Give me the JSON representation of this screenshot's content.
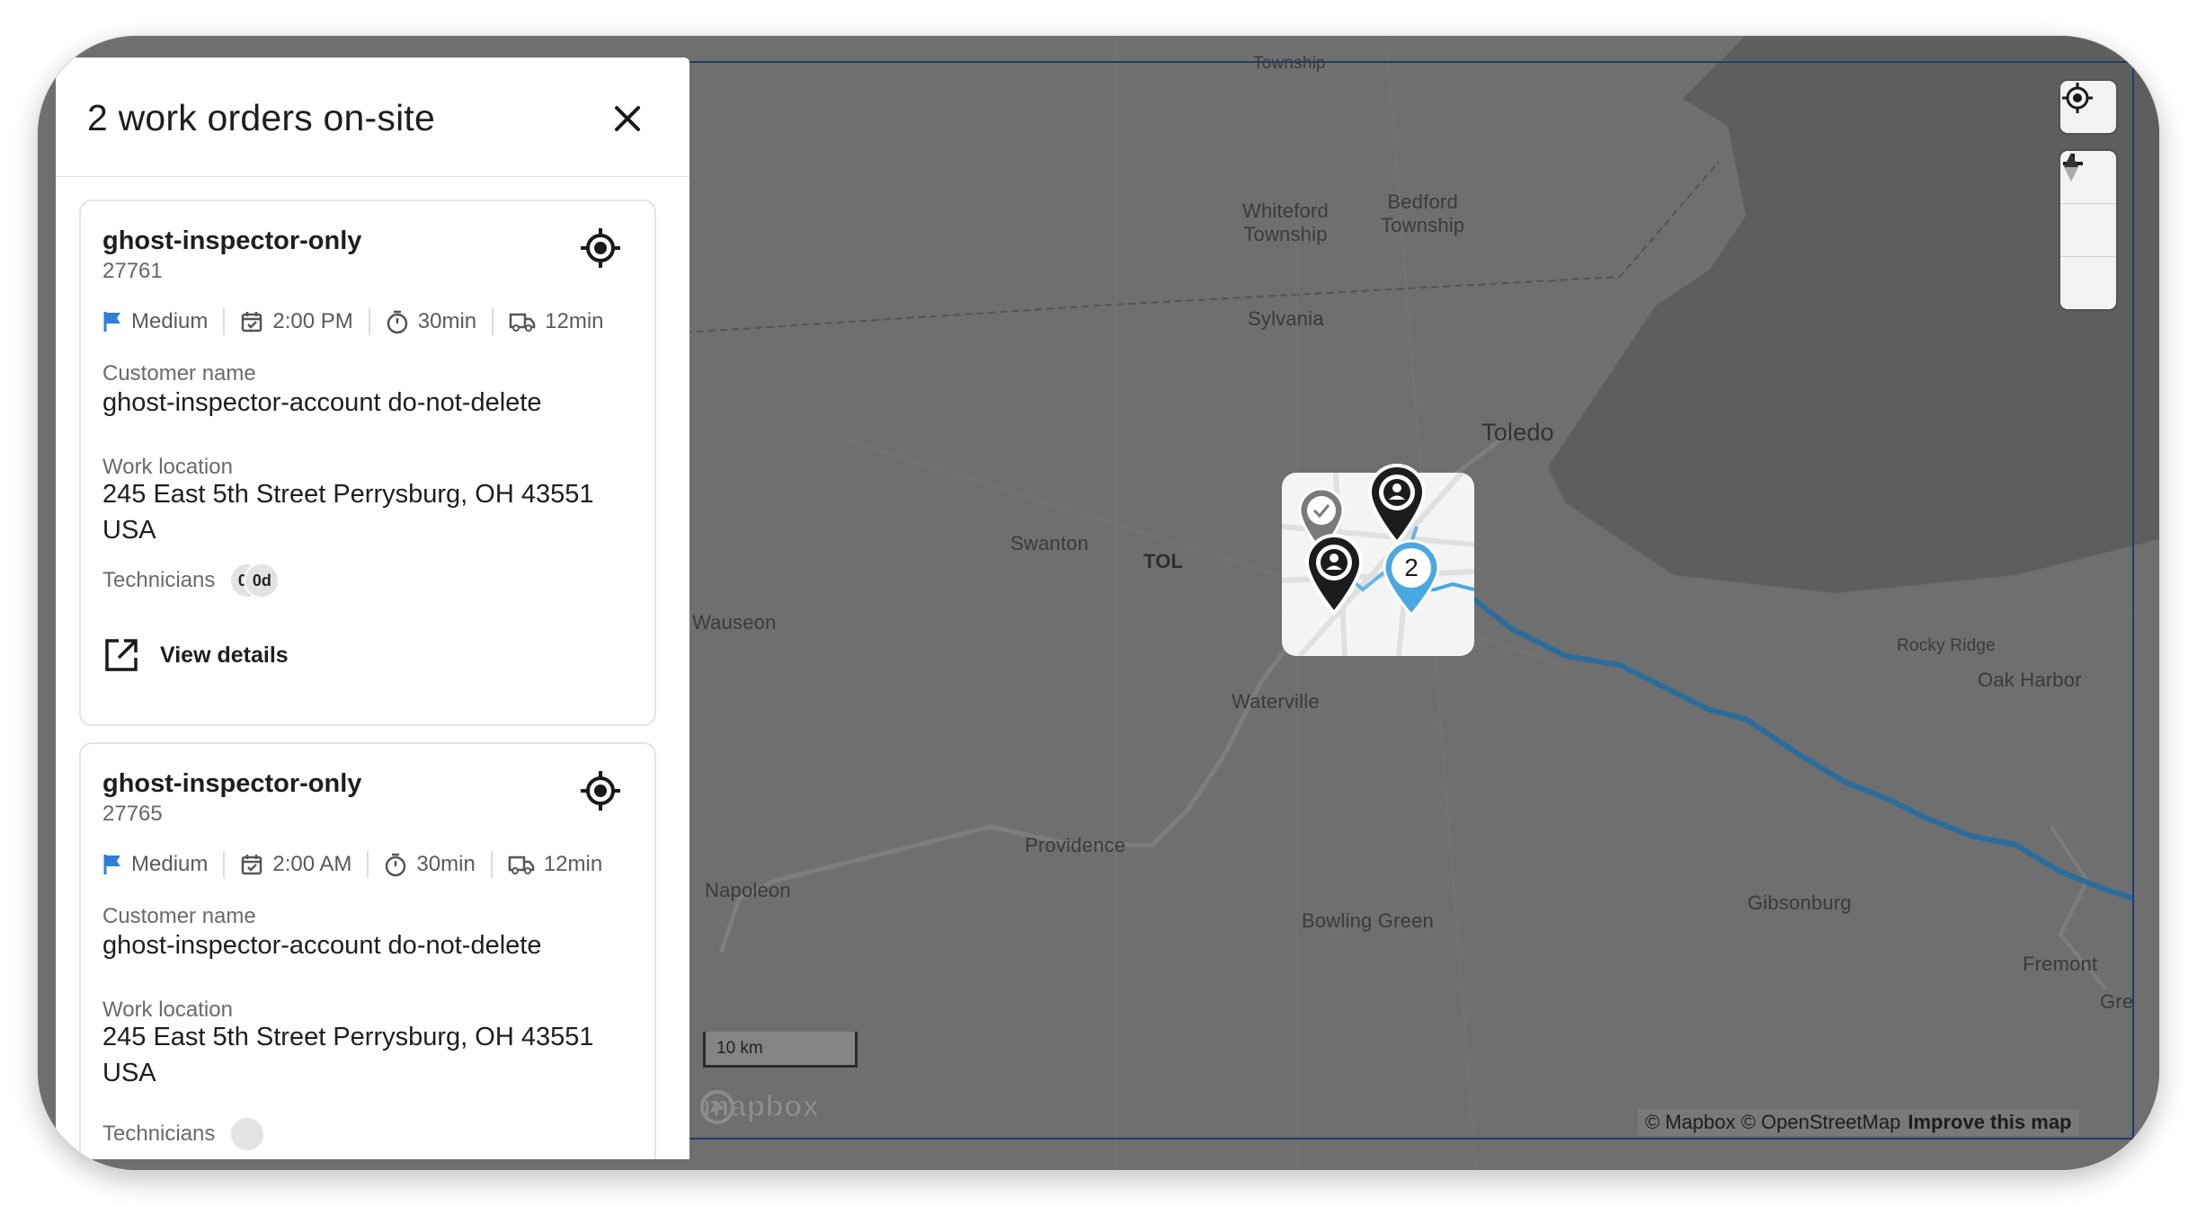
{
  "panel": {
    "title": "2 work orders on-site",
    "close_icon": "close-icon"
  },
  "work_orders": [
    {
      "name": "ghost-inspector-only",
      "id": "27761",
      "priority": "Medium",
      "time": "2:00 PM",
      "duration": "30min",
      "travel": "12min",
      "customer_label": "Customer name",
      "customer": "ghost-inspector-account do-not-delete",
      "location_label": "Work location",
      "location": "245 East 5th Street Perrysburg, OH 43551 USA",
      "technicians_label": "Technicians",
      "technician_initials": [
        "0d",
        "0d"
      ],
      "view_details": "View details"
    },
    {
      "name": "ghost-inspector-only",
      "id": "27765",
      "priority": "Medium",
      "time": "2:00 AM",
      "duration": "30min",
      "travel": "12min",
      "customer_label": "Customer name",
      "customer": "ghost-inspector-account do-not-delete",
      "location_label": "Work location",
      "location": "245 East 5th Street Perrysburg, OH 43551 USA",
      "technicians_label": "Technicians"
    }
  ],
  "map": {
    "places": {
      "township_top": "Township",
      "whiteford": "Whiteford\nTownship",
      "bedford": "Bedford\nTownship",
      "sylvania": "Sylvania",
      "toledo": "Toledo",
      "swanton": "Swanton",
      "tol": "TOL",
      "wauseon": "Wauseon",
      "waterville": "Waterville",
      "providence": "Providence",
      "napoleon": "Napoleon",
      "bowling_green": "Bowling Green",
      "gibsonburg": "Gibsonburg",
      "rocky_ridge": "Rocky Ridge",
      "oak_harbor": "Oak Harbor",
      "fremont": "Fremont",
      "gre": "Gre"
    },
    "cluster_count": "2",
    "scale": "10 km",
    "logo": "mapbox",
    "attribution": "© Mapbox © OpenStreetMap",
    "improve": "Improve this map",
    "route_color": "#2b6d9c",
    "accent_color": "#4aa8e0"
  }
}
